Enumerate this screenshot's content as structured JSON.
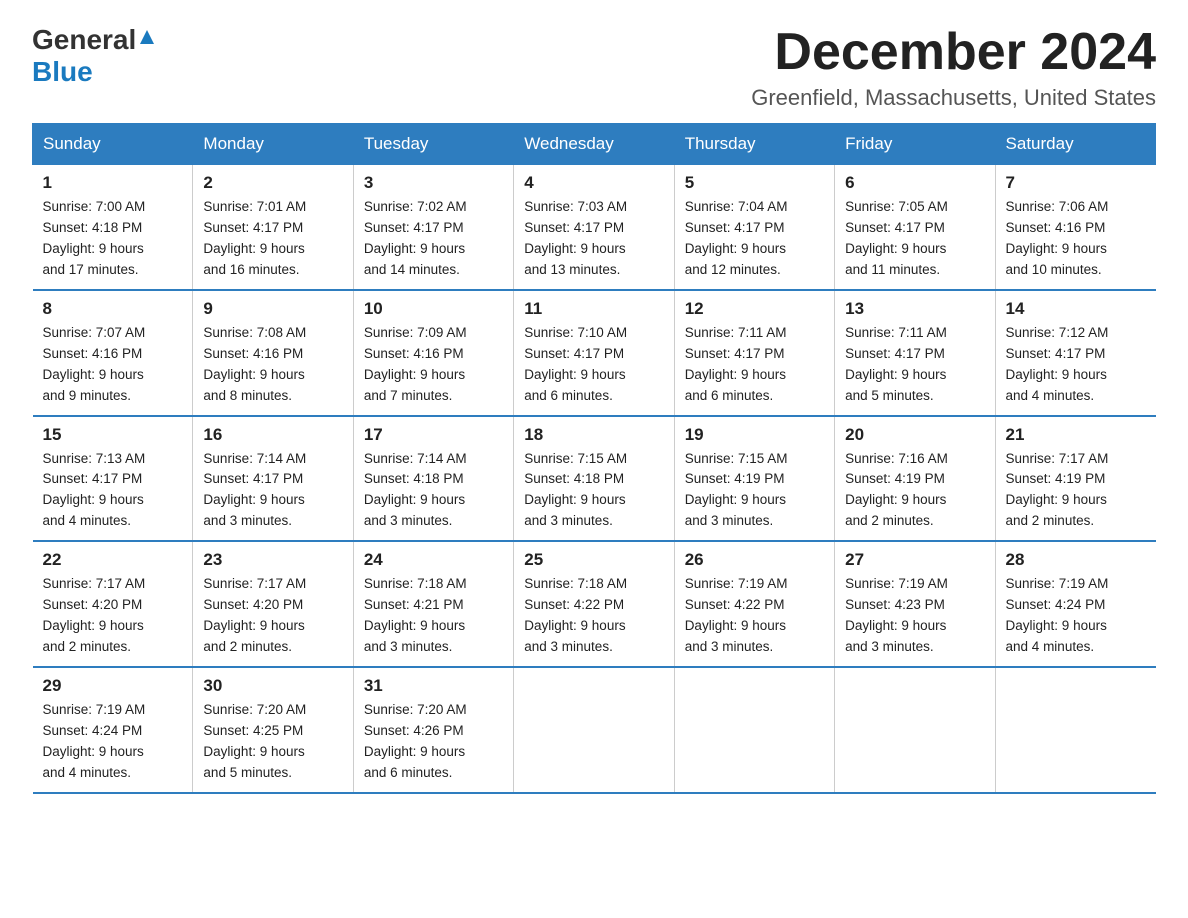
{
  "header": {
    "logo_general": "General",
    "logo_blue": "Blue",
    "month_year": "December 2024",
    "location": "Greenfield, Massachusetts, United States"
  },
  "days_of_week": [
    "Sunday",
    "Monday",
    "Tuesday",
    "Wednesday",
    "Thursday",
    "Friday",
    "Saturday"
  ],
  "weeks": [
    [
      {
        "day": "1",
        "sunrise": "7:00 AM",
        "sunset": "4:18 PM",
        "daylight": "9 hours and 17 minutes."
      },
      {
        "day": "2",
        "sunrise": "7:01 AM",
        "sunset": "4:17 PM",
        "daylight": "9 hours and 16 minutes."
      },
      {
        "day": "3",
        "sunrise": "7:02 AM",
        "sunset": "4:17 PM",
        "daylight": "9 hours and 14 minutes."
      },
      {
        "day": "4",
        "sunrise": "7:03 AM",
        "sunset": "4:17 PM",
        "daylight": "9 hours and 13 minutes."
      },
      {
        "day": "5",
        "sunrise": "7:04 AM",
        "sunset": "4:17 PM",
        "daylight": "9 hours and 12 minutes."
      },
      {
        "day": "6",
        "sunrise": "7:05 AM",
        "sunset": "4:17 PM",
        "daylight": "9 hours and 11 minutes."
      },
      {
        "day": "7",
        "sunrise": "7:06 AM",
        "sunset": "4:16 PM",
        "daylight": "9 hours and 10 minutes."
      }
    ],
    [
      {
        "day": "8",
        "sunrise": "7:07 AM",
        "sunset": "4:16 PM",
        "daylight": "9 hours and 9 minutes."
      },
      {
        "day": "9",
        "sunrise": "7:08 AM",
        "sunset": "4:16 PM",
        "daylight": "9 hours and 8 minutes."
      },
      {
        "day": "10",
        "sunrise": "7:09 AM",
        "sunset": "4:16 PM",
        "daylight": "9 hours and 7 minutes."
      },
      {
        "day": "11",
        "sunrise": "7:10 AM",
        "sunset": "4:17 PM",
        "daylight": "9 hours and 6 minutes."
      },
      {
        "day": "12",
        "sunrise": "7:11 AM",
        "sunset": "4:17 PM",
        "daylight": "9 hours and 6 minutes."
      },
      {
        "day": "13",
        "sunrise": "7:11 AM",
        "sunset": "4:17 PM",
        "daylight": "9 hours and 5 minutes."
      },
      {
        "day": "14",
        "sunrise": "7:12 AM",
        "sunset": "4:17 PM",
        "daylight": "9 hours and 4 minutes."
      }
    ],
    [
      {
        "day": "15",
        "sunrise": "7:13 AM",
        "sunset": "4:17 PM",
        "daylight": "9 hours and 4 minutes."
      },
      {
        "day": "16",
        "sunrise": "7:14 AM",
        "sunset": "4:17 PM",
        "daylight": "9 hours and 3 minutes."
      },
      {
        "day": "17",
        "sunrise": "7:14 AM",
        "sunset": "4:18 PM",
        "daylight": "9 hours and 3 minutes."
      },
      {
        "day": "18",
        "sunrise": "7:15 AM",
        "sunset": "4:18 PM",
        "daylight": "9 hours and 3 minutes."
      },
      {
        "day": "19",
        "sunrise": "7:15 AM",
        "sunset": "4:19 PM",
        "daylight": "9 hours and 3 minutes."
      },
      {
        "day": "20",
        "sunrise": "7:16 AM",
        "sunset": "4:19 PM",
        "daylight": "9 hours and 2 minutes."
      },
      {
        "day": "21",
        "sunrise": "7:17 AM",
        "sunset": "4:19 PM",
        "daylight": "9 hours and 2 minutes."
      }
    ],
    [
      {
        "day": "22",
        "sunrise": "7:17 AM",
        "sunset": "4:20 PM",
        "daylight": "9 hours and 2 minutes."
      },
      {
        "day": "23",
        "sunrise": "7:17 AM",
        "sunset": "4:20 PM",
        "daylight": "9 hours and 2 minutes."
      },
      {
        "day": "24",
        "sunrise": "7:18 AM",
        "sunset": "4:21 PM",
        "daylight": "9 hours and 3 minutes."
      },
      {
        "day": "25",
        "sunrise": "7:18 AM",
        "sunset": "4:22 PM",
        "daylight": "9 hours and 3 minutes."
      },
      {
        "day": "26",
        "sunrise": "7:19 AM",
        "sunset": "4:22 PM",
        "daylight": "9 hours and 3 minutes."
      },
      {
        "day": "27",
        "sunrise": "7:19 AM",
        "sunset": "4:23 PM",
        "daylight": "9 hours and 3 minutes."
      },
      {
        "day": "28",
        "sunrise": "7:19 AM",
        "sunset": "4:24 PM",
        "daylight": "9 hours and 4 minutes."
      }
    ],
    [
      {
        "day": "29",
        "sunrise": "7:19 AM",
        "sunset": "4:24 PM",
        "daylight": "9 hours and 4 minutes."
      },
      {
        "day": "30",
        "sunrise": "7:20 AM",
        "sunset": "4:25 PM",
        "daylight": "9 hours and 5 minutes."
      },
      {
        "day": "31",
        "sunrise": "7:20 AM",
        "sunset": "4:26 PM",
        "daylight": "9 hours and 6 minutes."
      },
      null,
      null,
      null,
      null
    ]
  ],
  "labels": {
    "sunrise": "Sunrise:",
    "sunset": "Sunset:",
    "daylight": "Daylight:"
  }
}
